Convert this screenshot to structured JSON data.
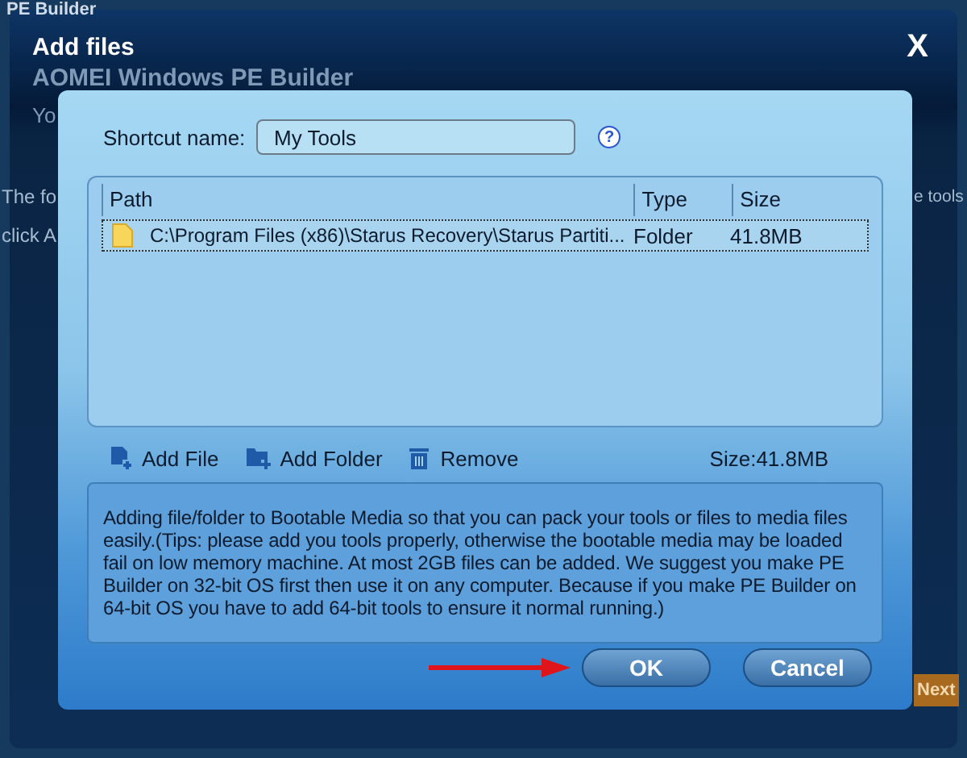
{
  "background_app": {
    "title": "PE Builder",
    "heading": "AOMEI Windows PE Builder",
    "subtitle": "Yo",
    "text_left_1": "The fo",
    "text_left_2": "click A",
    "text_right": "e tools",
    "next_button": "Next"
  },
  "dialog": {
    "title": "Add files",
    "close": "X"
  },
  "shortcut": {
    "label": "Shortcut name:",
    "value": "My Tools",
    "help": "?"
  },
  "table": {
    "columns": [
      "Path",
      "Type",
      "Size"
    ],
    "rows": [
      {
        "path": "C:\\Program Files (x86)\\Starus Recovery\\Starus Partiti...",
        "type": "Folder",
        "size": "41.8MB",
        "selected": true
      }
    ]
  },
  "toolbar": [
    {
      "label": "Add File",
      "kind": "file"
    },
    {
      "label": "Add Folder",
      "kind": "folder"
    },
    {
      "label": "Remove",
      "kind": "remove"
    }
  ],
  "total_size": "Size:41.8MB",
  "info": "Adding file/folder to Bootable Media so that you can pack your tools or files to media files easily.(Tips: please add you tools properly, otherwise the bootable media may be loaded fail on low memory machine. At most 2GB files can be added. We suggest you make PE Builder on 32-bit OS first then use it on any computer. Because if you make PE Builder on 64-bit OS you have to add 64-bit tools to ensure it normal running.)",
  "buttons": [
    "OK",
    "Cancel"
  ]
}
